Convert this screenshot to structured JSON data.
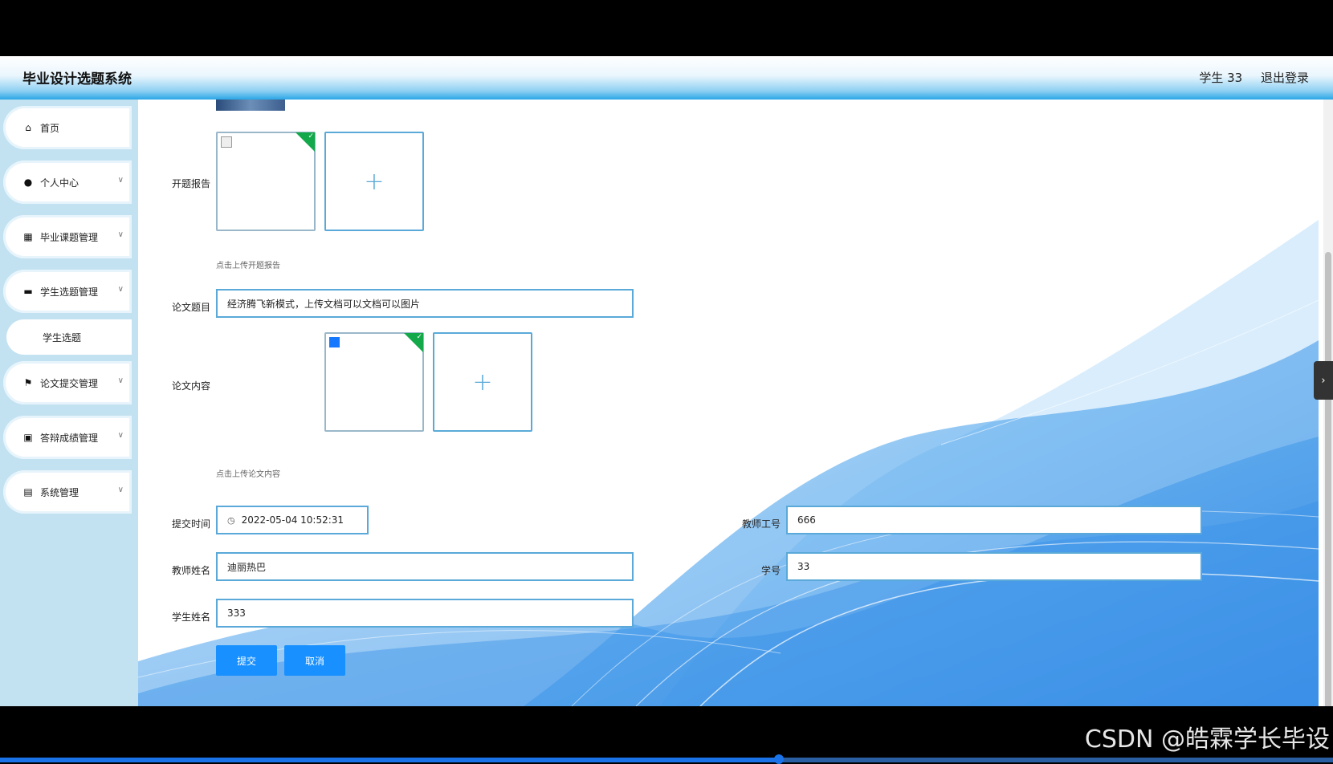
{
  "header": {
    "title": "毕业设计选题系统",
    "user": "学生 33",
    "logout": "退出登录"
  },
  "sidebar": {
    "items": [
      {
        "label": "首页",
        "icon": "home-icon"
      },
      {
        "label": "个人中心",
        "icon": "user-icon"
      },
      {
        "label": "毕业课题管理",
        "icon": "grid-icon"
      },
      {
        "label": "学生选题管理",
        "icon": "chat-icon"
      },
      {
        "label": "学生选题",
        "icon": ""
      },
      {
        "label": "论文提交管理",
        "icon": "flag-icon"
      },
      {
        "label": "答辩成绩管理",
        "icon": "clipboard-icon"
      },
      {
        "label": "系统管理",
        "icon": "document-icon"
      }
    ]
  },
  "form": {
    "proposal_label": "开题报告",
    "proposal_hint": "点击上传开题报告",
    "title_label": "论文题目",
    "title_value": "经济腾飞新模式，上传文档可以文档可以图片",
    "content_label": "论文内容",
    "content_hint": "点击上传论文内容",
    "time_label": "提交时间",
    "time_value": "2022-05-04 10:52:31",
    "teacher_id_label": "教师工号",
    "teacher_id_value": "666",
    "teacher_name_label": "教师姓名",
    "teacher_name_value": "迪丽热巴",
    "student_id_label": "学号",
    "student_id_value": "33",
    "student_name_label": "学生姓名",
    "student_name_value": "333",
    "submit_label": "提交",
    "cancel_label": "取消"
  },
  "watermark": "CSDN @皓霖学长毕设",
  "colors": {
    "accent": "#1890ff",
    "border": "#5aa9d8",
    "sidebar": "#c3e2f1",
    "check": "#13a84a"
  }
}
